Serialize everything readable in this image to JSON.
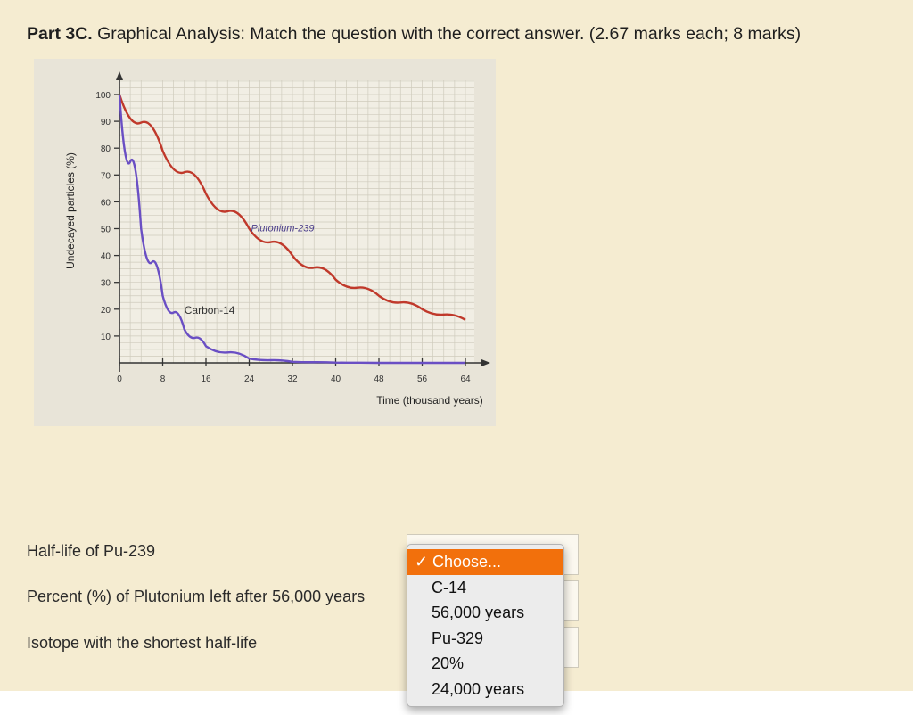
{
  "question": {
    "part_label": "Part 3C.",
    "instruction": " Graphical Analysis: Match the question with the correct answer. (2.67 marks each; 8 marks)"
  },
  "chart_data": {
    "type": "line",
    "xlabel": "Time (thousand years)",
    "ylabel": "Undecayed particles (%)",
    "x_ticks": [
      0,
      8,
      16,
      24,
      32,
      40,
      48,
      56,
      64
    ],
    "y_ticks": [
      10,
      20,
      30,
      40,
      50,
      60,
      70,
      80,
      90,
      100
    ],
    "xlim": [
      0,
      64
    ],
    "ylim": [
      0,
      100
    ],
    "grid": true,
    "series": [
      {
        "name": "Plutonium-239",
        "color": "#c0392b",
        "x": [
          0,
          8,
          16,
          24,
          32,
          40,
          48,
          56,
          64
        ],
        "y": [
          100,
          79,
          63,
          50,
          40,
          31,
          25,
          20,
          16
        ]
      },
      {
        "name": "Carbon-14",
        "color": "#6a4fc4",
        "x": [
          0,
          4,
          8,
          12,
          16,
          24,
          32,
          40,
          48,
          56,
          64
        ],
        "y": [
          100,
          50,
          25,
          12.5,
          6.2,
          1.6,
          0.4,
          0.1,
          0,
          0,
          0
        ]
      }
    ]
  },
  "rows": [
    {
      "label": "Half-life of Pu-239"
    },
    {
      "label": "Percent (%) of Plutonium left after 56,000 years"
    },
    {
      "label": "Isotope with the shortest half-life"
    }
  ],
  "dropdown": {
    "check_glyph": "✓",
    "options": [
      {
        "label": "Choose...",
        "selected": true
      },
      {
        "label": "C-14"
      },
      {
        "label": "56,000 years"
      },
      {
        "label": "Pu-329"
      },
      {
        "label": "20%"
      },
      {
        "label": "24,000 years"
      }
    ]
  },
  "colors": {
    "panel_bg": "#f5ecd1",
    "highlight": "#f2700c"
  }
}
